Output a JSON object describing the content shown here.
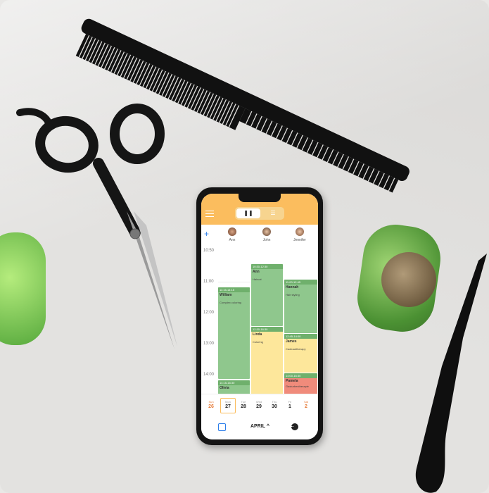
{
  "app": {
    "view_toggle": {
      "day_icon": "pause-icon",
      "list_icon": "list-icon"
    },
    "staff": [
      {
        "name": "Ann"
      },
      {
        "name": "John"
      },
      {
        "name": "Jennifer"
      }
    ],
    "times": [
      "10:50",
      "11:00",
      "12:00",
      "13:00",
      "14:00"
    ],
    "appointments": [
      {
        "time": "10:30-12:30",
        "client": "Ann",
        "service": "Haircut"
      },
      {
        "time": "11:15-14:15",
        "client": "William",
        "service": "Complex coloring"
      },
      {
        "time": "11:00-12:45",
        "client": "Hannah",
        "service": "Hair styling"
      },
      {
        "time": "12:30-16:30",
        "client": "Linda",
        "service": "Coloring"
      },
      {
        "time": "12:45-14:00",
        "client": "James",
        "service": "Cadeauttherapy"
      },
      {
        "time": "14:00-16:30",
        "client": "Pamela",
        "service": "Gasturbestherapie"
      },
      {
        "time": "14:15-16:30",
        "client": "Olivia",
        "service": ""
      }
    ],
    "week": [
      {
        "name": "Sun",
        "date": "26"
      },
      {
        "name": "Mon",
        "date": "27"
      },
      {
        "name": "Tue",
        "date": "28"
      },
      {
        "name": "Wed",
        "date": "29"
      },
      {
        "name": "Thu",
        "date": "30"
      },
      {
        "name": "Fri",
        "date": "1"
      },
      {
        "name": "Sat",
        "date": "2"
      }
    ],
    "month": "APRIL ^",
    "colors": {
      "header": "#fbbd5e",
      "green": "#8fc78d",
      "yellow": "#fde79b",
      "red": "#f08b7b",
      "accent": "#2b7de9"
    }
  }
}
